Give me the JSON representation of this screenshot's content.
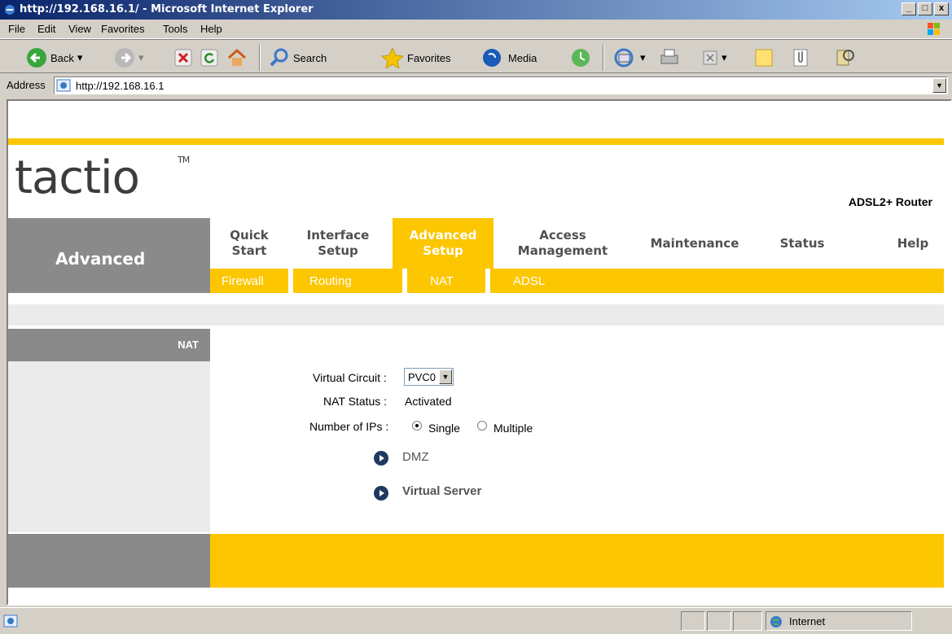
{
  "window": {
    "title": "http://192.168.16.1/ - Microsoft Internet Explorer",
    "buttons": [
      "_",
      "□",
      "x"
    ]
  },
  "menu": [
    "File",
    "Edit",
    "View",
    "Favorites",
    "Tools",
    "Help"
  ],
  "toolbar": {
    "back": "Back",
    "search": "Search",
    "favorites": "Favorites",
    "media": "Media"
  },
  "address": {
    "label": "Address",
    "url": "http://192.168.16.1"
  },
  "page": {
    "logo": "tactio",
    "logo_tm": "TM",
    "product": "ADSL2+ Router",
    "section": "Advanced",
    "nav_tabs": [
      {
        "label": "Quick\nStart",
        "active": false
      },
      {
        "label": "Interface\nSetup",
        "active": false
      },
      {
        "label": "Advanced\nSetup",
        "active": true
      },
      {
        "label": "Access\nManagement",
        "active": false
      },
      {
        "label": "Maintenance",
        "active": false
      },
      {
        "label": "Status",
        "active": false
      },
      {
        "label": "Help",
        "active": false
      }
    ],
    "sub_tabs": [
      "Firewall",
      "Routing",
      "NAT",
      "ADSL"
    ],
    "panel_title": "NAT",
    "form": {
      "virtual_circuit_label": "Virtual Circuit :",
      "virtual_circuit_value": "PVC0",
      "nat_status_label": "NAT Status :",
      "nat_status_value": "Activated",
      "num_ips_label": "Number of IPs :",
      "option_single": "Single",
      "option_multiple": "Multiple",
      "selected": "Single"
    },
    "links": [
      "DMZ",
      "Virtual Server"
    ]
  },
  "status": {
    "zone": "Internet"
  },
  "colors": {
    "accent": "#fcc600",
    "nav_grey": "#8a8a8a",
    "logo_red": "#d40000"
  }
}
